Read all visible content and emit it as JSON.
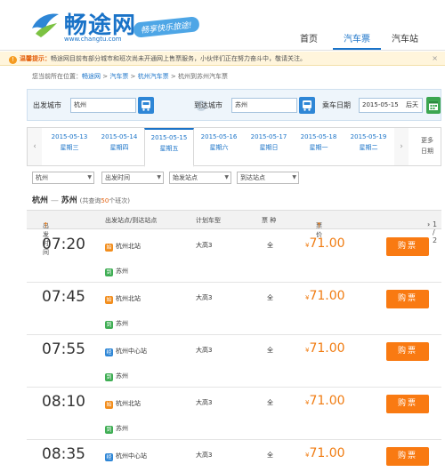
{
  "header": {
    "logo_text": "畅途网",
    "logo_url": "www.changtu.com",
    "slogan": "畅享快乐旅途!",
    "nav": [
      {
        "label": "首页"
      },
      {
        "label": "汽车票"
      },
      {
        "label": "汽车站"
      }
    ]
  },
  "notice": {
    "label": "温馨提示：",
    "text": "畅途网目前有部分城市和班次尚未开通网上售票服务，小伙伴们正在努力奋斗中，敬请关注。",
    "close": "×"
  },
  "breadcrumb": {
    "prefix": "您当前所在位置：",
    "items": [
      "畅途网",
      "汽车票",
      "杭州汽车票",
      "杭州到苏州汽车票"
    ],
    "sep": " > "
  },
  "search": {
    "from_label": "出发城市",
    "from_value": "杭州",
    "to_label": "到达城市",
    "to_value": "苏州",
    "date_label": "乘车日期",
    "date_value": "2015-05-15",
    "date_suffix": "后天"
  },
  "dates": {
    "days": [
      {
        "date": "2015-05-13",
        "weekday": "星期三"
      },
      {
        "date": "2015-05-14",
        "weekday": "星期四"
      },
      {
        "date": "2015-05-15",
        "weekday": "星期五"
      },
      {
        "date": "2015-05-16",
        "weekday": "星期六"
      },
      {
        "date": "2015-05-17",
        "weekday": "星期日"
      },
      {
        "date": "2015-05-18",
        "weekday": "星期一"
      },
      {
        "date": "2015-05-19",
        "weekday": "星期二"
      }
    ],
    "more_line1": "更多",
    "more_line2": "日期"
  },
  "filters": [
    "杭州",
    "出发时间",
    "始发站点",
    "到达站点"
  ],
  "route": {
    "from": "杭州",
    "arrow": "—",
    "to": "苏州",
    "count_prefix": "(共查询",
    "count": "50",
    "count_suffix": "个班次)"
  },
  "table": {
    "headers": [
      "出发时间",
      "出发站点/到达站点",
      "计划车型",
      "票 种",
      "票 价"
    ],
    "pager": "1 / 2"
  },
  "rows": [
    {
      "time": "07:20",
      "from_tag": "始",
      "from": "杭州北站",
      "to_tag": "到",
      "to": "苏州",
      "bus": "大高3",
      "ticket": "全",
      "currency": "¥",
      "price": "71.00",
      "buy": "购票"
    },
    {
      "time": "07:45",
      "from_tag": "始",
      "from": "杭州北站",
      "to_tag": "到",
      "to": "苏州",
      "bus": "大高3",
      "ticket": "全",
      "currency": "¥",
      "price": "71.00",
      "buy": "购票"
    },
    {
      "time": "07:55",
      "from_tag": "经",
      "from": "杭州中心站",
      "to_tag": "到",
      "to": "苏州",
      "bus": "大高3",
      "ticket": "全",
      "currency": "¥",
      "price": "71.00",
      "buy": "购票"
    },
    {
      "time": "08:10",
      "from_tag": "始",
      "from": "杭州北站",
      "to_tag": "到",
      "to": "苏州",
      "bus": "大高3",
      "ticket": "全",
      "currency": "¥",
      "price": "71.00",
      "buy": "购票"
    },
    {
      "time": "08:35",
      "from_tag": "经",
      "from": "杭州中心站",
      "to_tag": "到",
      "to": "苏州",
      "bus": "大高3",
      "ticket": "全",
      "currency": "¥",
      "price": "71.00",
      "buy": "购票"
    }
  ]
}
